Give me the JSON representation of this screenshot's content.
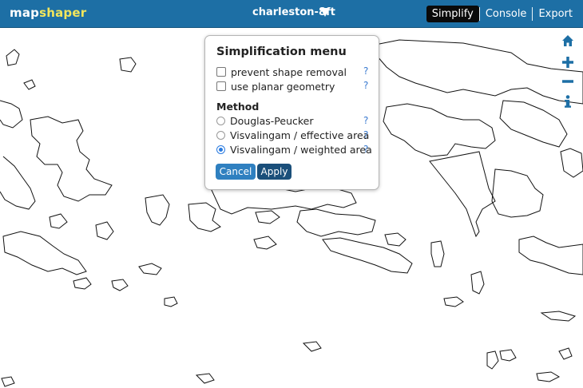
{
  "app": {
    "logo_part1": "map",
    "logo_part2": "shaper"
  },
  "layer": {
    "name": "charleston-8ft"
  },
  "menu": {
    "simplify": "Simplify",
    "console": "Console",
    "export": "Export"
  },
  "map_tools": [
    "home-icon",
    "zoom-in-icon",
    "zoom-out-icon",
    "info-icon"
  ],
  "simplify_menu": {
    "title": "Simplification menu",
    "options": [
      {
        "label": "prevent shape removal",
        "checked": false,
        "help": "?"
      },
      {
        "label": "use planar geometry",
        "checked": false,
        "help": "?"
      }
    ],
    "method_heading": "Method",
    "methods": [
      {
        "label": "Douglas-Peucker",
        "selected": false,
        "help": "?"
      },
      {
        "label": "Visvalingam / effective area",
        "selected": false,
        "help": "?"
      },
      {
        "label": "Visvalingam / weighted area",
        "selected": true,
        "help": "?"
      }
    ],
    "cancel_label": "Cancel",
    "apply_label": "Apply"
  },
  "colors": {
    "header": "#1d6fa5",
    "logo_accent": "#f2e65c",
    "active_tab": "#0a0a0a",
    "primary_button": "#2f80c0",
    "apply_button": "#1a4f7a",
    "radio_selected": "#2a7be0"
  }
}
